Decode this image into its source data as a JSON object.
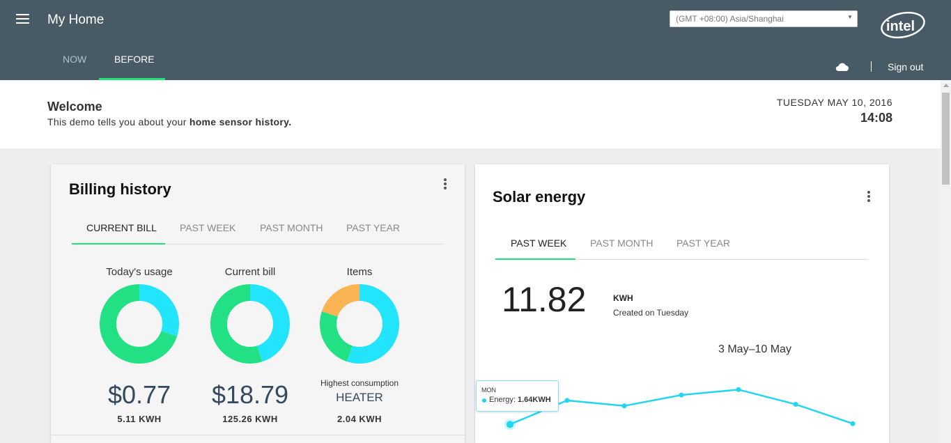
{
  "header": {
    "app_title": "My Home",
    "timezone": "(GMT +08:00) Asia/Shanghai",
    "tabs": [
      {
        "label": "NOW"
      },
      {
        "label": "BEFORE"
      }
    ],
    "active_tab": "BEFORE",
    "logo_text": "intel",
    "sign_out": "Sign out"
  },
  "welcome": {
    "title": "Welcome",
    "text_prefix": "This demo tells you about your ",
    "text_bold": "home sensor history.",
    "date": "TUESDAY MAY 10, 2016",
    "time": "14:08"
  },
  "billing": {
    "title": "Billing history",
    "tabs": [
      {
        "label": "CURRENT BILL"
      },
      {
        "label": "PAST WEEK"
      },
      {
        "label": "PAST MONTH"
      },
      {
        "label": "PAST YEAR"
      }
    ],
    "active_tab": "CURRENT BILL",
    "metrics": [
      {
        "label": "Today's usage",
        "value": "$0.77",
        "sub": "5.11 KWH",
        "slices": [
          {
            "fraction": 0.3,
            "color": "#22e5fb"
          },
          {
            "fraction": 0.7,
            "color": "#22e084"
          }
        ]
      },
      {
        "label": "Current bill",
        "value": "$18.79",
        "sub": "125.26 KWH",
        "slices": [
          {
            "fraction": 0.45,
            "color": "#22e5fb"
          },
          {
            "fraction": 0.55,
            "color": "#22e084"
          }
        ]
      },
      {
        "label": "Items",
        "value_label": "Highest consumption",
        "value": "HEATER",
        "sub": "2.04 KWH",
        "slices": [
          {
            "fraction": 0.55,
            "color": "#22e5fb"
          },
          {
            "fraction": 0.25,
            "color": "#22e084"
          },
          {
            "fraction": 0.2,
            "color": "#fbb454"
          }
        ]
      }
    ]
  },
  "solar": {
    "title": "Solar energy",
    "tabs": [
      {
        "label": "PAST WEEK"
      },
      {
        "label": "PAST MONTH"
      },
      {
        "label": "PAST YEAR"
      }
    ],
    "active_tab": "PAST WEEK",
    "value": "11.82",
    "unit": "KWH",
    "created": "Created on Tuesday",
    "range": "3 May–10 May",
    "tooltip": {
      "day": "MON",
      "label": "Energy:",
      "value": "1.64KWH"
    },
    "line_color": "#22d6f3"
  },
  "chart_data": {
    "type": "line",
    "series": [
      {
        "name": "Energy",
        "values": [
          1.64,
          1.95,
          1.88,
          2.02,
          2.09,
          1.9,
          1.65
        ]
      }
    ],
    "ylim": [
      1.4,
      2.3
    ]
  }
}
